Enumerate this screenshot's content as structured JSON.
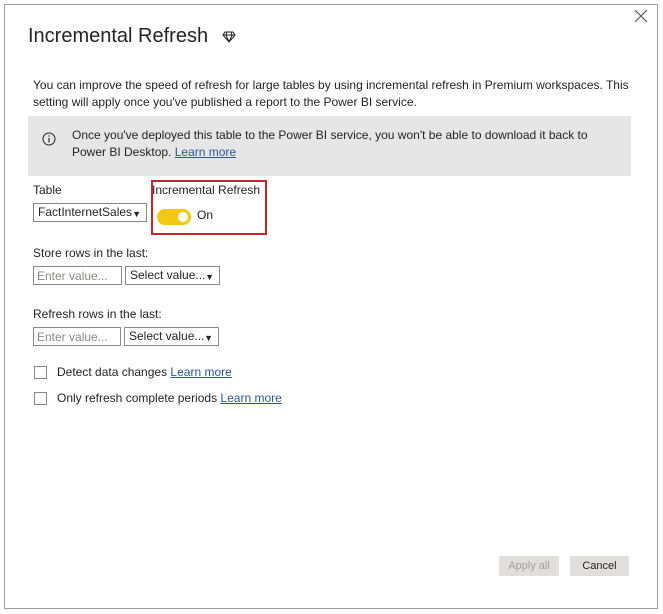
{
  "dialog": {
    "title": "Incremental Refresh",
    "premium_icon": "diamond-icon",
    "close_icon": "close-icon",
    "description": "You can improve the speed of refresh for large tables by using incremental refresh in Premium workspaces. This setting will apply once you've published a report to the Power BI service."
  },
  "info": {
    "icon": "info-icon",
    "text": "Once you've deployed this table to the Power BI service, you won't be able to download it back to Power BI Desktop.",
    "link": "Learn more"
  },
  "table": {
    "label": "Table",
    "selected": "FactInternetSales"
  },
  "incremental": {
    "label": "Incremental Refresh",
    "state": "On",
    "accent_color": "#f2c811",
    "highlight_color": "#c4262e"
  },
  "store": {
    "label": "Store rows in the last:",
    "value_placeholder": "Enter value...",
    "period_selected": "Select value..."
  },
  "refresh": {
    "label": "Refresh rows in the last:",
    "value_placeholder": "Enter value...",
    "period_selected": "Select value..."
  },
  "options": {
    "detect_label": "Detect data changes",
    "detect_link": "Learn more",
    "complete_label": "Only refresh complete periods",
    "complete_link": "Learn more"
  },
  "buttons": {
    "apply": "Apply all",
    "cancel": "Cancel"
  }
}
